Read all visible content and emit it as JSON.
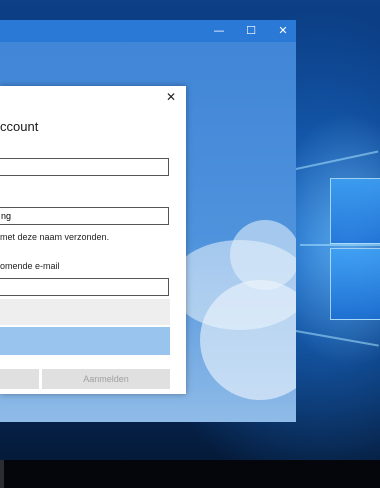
{
  "window": {
    "minimize_glyph": "—",
    "maximize_glyph": "☐",
    "close_glyph": "✕"
  },
  "dialog": {
    "title": "ccount",
    "close_glyph": "✕",
    "field1_value": "",
    "field2_value": "ng",
    "hint_text": "met deze naam verzonden.",
    "email_label": "omende e-mail",
    "field3_value": "",
    "signin_button": "Aanmelden"
  },
  "colors": {
    "accent": "#2b79d6",
    "selected_row": "#99c4ee"
  }
}
